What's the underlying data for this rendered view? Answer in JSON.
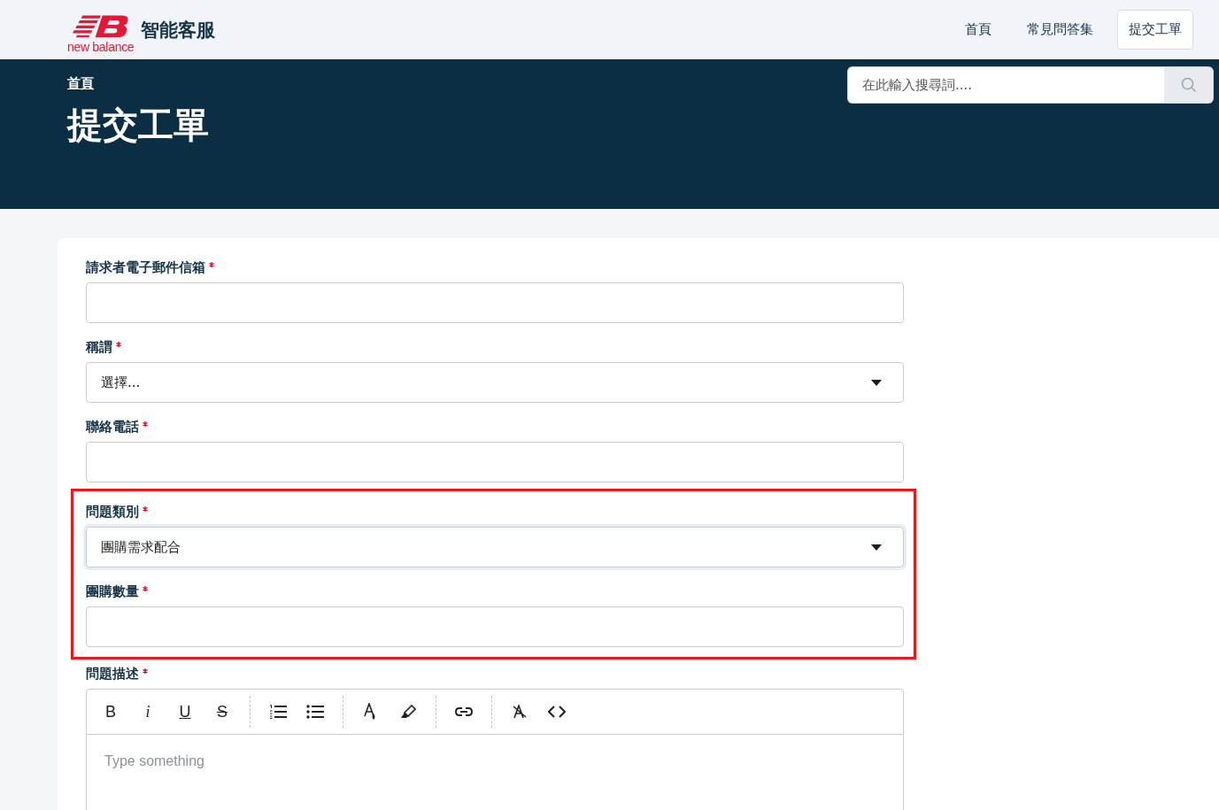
{
  "header": {
    "brand_wordmark": "new balance",
    "brand_title": "智能客服",
    "nav": [
      {
        "label": "首頁",
        "selected": false
      },
      {
        "label": "常見問答集",
        "selected": false
      },
      {
        "label": "提交工單",
        "selected": true
      }
    ]
  },
  "banner": {
    "breadcrumb": "首頁",
    "title": "提交工單",
    "search": {
      "placeholder": "在此輸入搜尋詞...."
    }
  },
  "form": {
    "sections": [
      {
        "highlighted": false,
        "fields": [
          {
            "kind": "text",
            "label": "請求者電子郵件信箱",
            "required": true
          },
          {
            "kind": "select",
            "label": "稱謂",
            "required": true,
            "value": "選擇..."
          },
          {
            "kind": "text",
            "label": "聯絡電話",
            "required": true
          }
        ]
      },
      {
        "highlighted": true,
        "fields": [
          {
            "kind": "select",
            "label": "問題類別",
            "required": true,
            "value": "團購需求配合"
          },
          {
            "kind": "text",
            "label": "團購數量",
            "required": true
          }
        ]
      },
      {
        "highlighted": false,
        "fields": [
          {
            "kind": "editor",
            "label": "問題描述",
            "required": true,
            "placeholder": "Type something",
            "toolbar": [
              [
                {
                  "kind": "bold",
                  "label": "B"
                },
                {
                  "kind": "italic",
                  "label": "i"
                },
                {
                  "kind": "underline",
                  "label": "U"
                },
                {
                  "kind": "strike",
                  "label": "S"
                }
              ],
              [
                {
                  "kind": "ordered-list"
                },
                {
                  "kind": "bullet-list"
                }
              ],
              [
                {
                  "kind": "font-color"
                },
                {
                  "kind": "highlight"
                }
              ],
              [
                {
                  "kind": "link"
                }
              ],
              [
                {
                  "kind": "clear-format"
                },
                {
                  "kind": "code"
                }
              ]
            ]
          }
        ]
      }
    ]
  }
}
